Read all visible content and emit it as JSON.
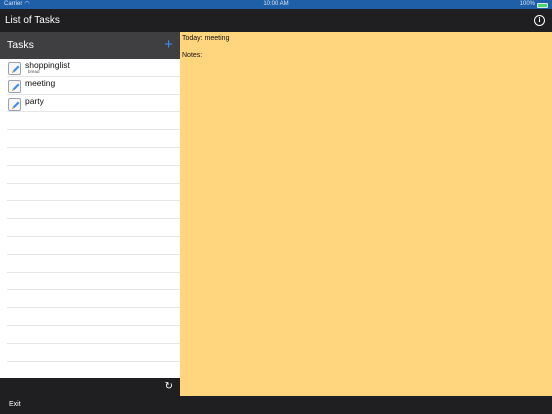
{
  "status_bar": {
    "carrier": "Carrier",
    "time": "10:00 AM",
    "battery_text": "100%",
    "battery_level": 1.0,
    "battery_color": "#4cd964"
  },
  "navbar": {
    "title": "List of Tasks",
    "info_icon": "info-icon"
  },
  "tasks_panel": {
    "header": "Tasks",
    "add_icon": "plus-icon",
    "accent_color": "#3d8ef0",
    "items": [
      {
        "name": "shoppinglist",
        "subtitle": "bread",
        "icon": "edit-checkbox-icon"
      },
      {
        "name": "meeting",
        "subtitle": "",
        "icon": "edit-checkbox-icon"
      },
      {
        "name": "party",
        "subtitle": "",
        "icon": "edit-checkbox-icon"
      }
    ],
    "footer_icon": "refresh-icon"
  },
  "detail": {
    "today": "Today: meeting",
    "notes": "Notes:",
    "background": "#ffd57e"
  },
  "toolbar": {
    "exit_label": "Exit"
  }
}
